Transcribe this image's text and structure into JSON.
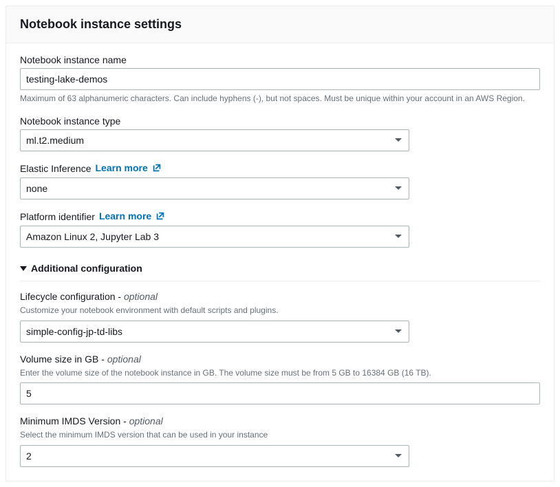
{
  "panel": {
    "title": "Notebook instance settings"
  },
  "fields": {
    "instance_name": {
      "label": "Notebook instance name",
      "value": "testing-lake-demos",
      "helper": "Maximum of 63 alphanumeric characters. Can include hyphens (-), but not spaces. Must be unique within your account in an AWS Region."
    },
    "instance_type": {
      "label": "Notebook instance type",
      "value": "ml.t2.medium"
    },
    "elastic_inference": {
      "label": "Elastic Inference",
      "learn_more": "Learn more",
      "value": "none"
    },
    "platform_identifier": {
      "label": "Platform identifier",
      "learn_more": "Learn more",
      "value": "Amazon Linux 2, Jupyter Lab 3"
    }
  },
  "additional": {
    "title": "Additional configuration",
    "lifecycle": {
      "label": "Lifecycle configuration - ",
      "optional": "optional",
      "helper": "Customize your notebook environment with default scripts and plugins.",
      "value": "simple-config-jp-td-libs"
    },
    "volume": {
      "label": "Volume size in GB - ",
      "optional": "optional",
      "helper": "Enter the volume size of the notebook instance in GB. The volume size must be from 5 GB to 16384 GB (16 TB).",
      "value": "5"
    },
    "imds": {
      "label": "Minimum IMDS Version - ",
      "optional": "optional",
      "helper": "Select the minimum IMDS version that can be used in your instance",
      "value": "2"
    }
  }
}
